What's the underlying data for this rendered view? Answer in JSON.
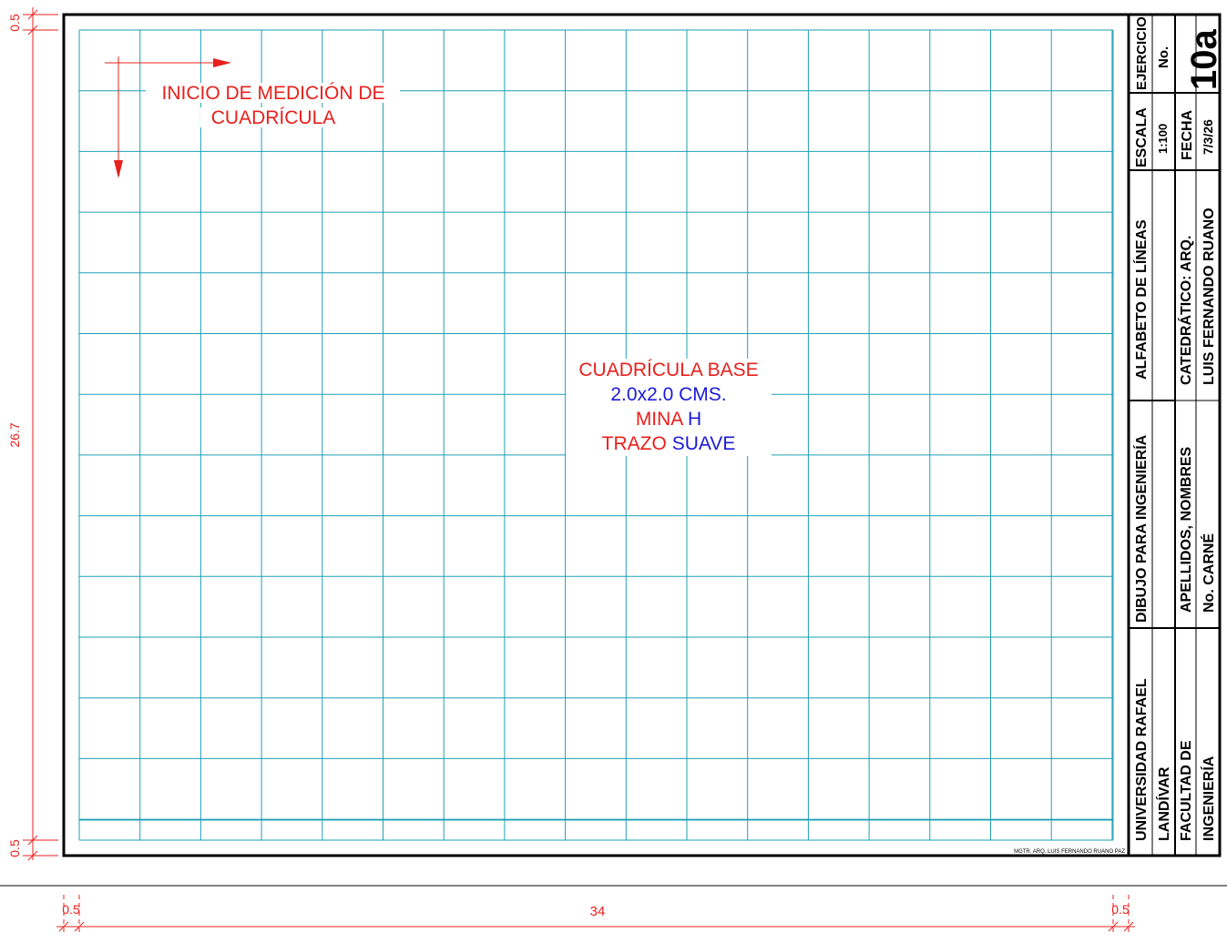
{
  "dimensions": {
    "top_margin": "0.5",
    "drawing_height": "26.7",
    "bottom_margin": "0.5",
    "left_margin": "0.5",
    "drawing_width": "34",
    "right_margin": "0.5"
  },
  "annotations": {
    "start_line1": "INICIO DE MEDICIÓN DE",
    "start_line2": "CUADRÍCULA",
    "base_title": "CUADRÍCULA BASE",
    "base_size": "2.0x2.0 CMS.",
    "lead_label": "MINA",
    "lead_value": "H",
    "stroke_label": "TRAZO",
    "stroke_value": "SUAVE"
  },
  "title_block": {
    "university_line1": "UNIVERSIDAD RAFAEL",
    "university_line2": "LANDÍVAR",
    "faculty_line1": "FACULTAD DE",
    "faculty_line2": "INGENIERÍA",
    "course": "DIBUJO PARA INGENIERÍA",
    "student_line1": "APELLIDOS, NOMBRES",
    "student_line2": "No. CARNÉ",
    "topic": "ALFABETO DE LÍNEAS",
    "professor_line1": "CATEDRÁTICO: ARQ.",
    "professor_line2": "LUIS FERNANDO RUANO",
    "scale_label": "ESCALA",
    "scale_value": "1:100",
    "date_label": "FECHA",
    "date_value": "7/3/26",
    "exercise_label": "EJERCICIO",
    "exercise_no_label": "No.",
    "exercise_number": "10a"
  },
  "credit": "MGTR. ARQ. LUIS FERNANDO RUANO PAZ",
  "colors": {
    "grid": "#1e9fb5",
    "annotation_red": "#e8201c",
    "annotation_blue": "#1a1ad6",
    "frame": "#000000",
    "dimension": "#e8201c"
  }
}
